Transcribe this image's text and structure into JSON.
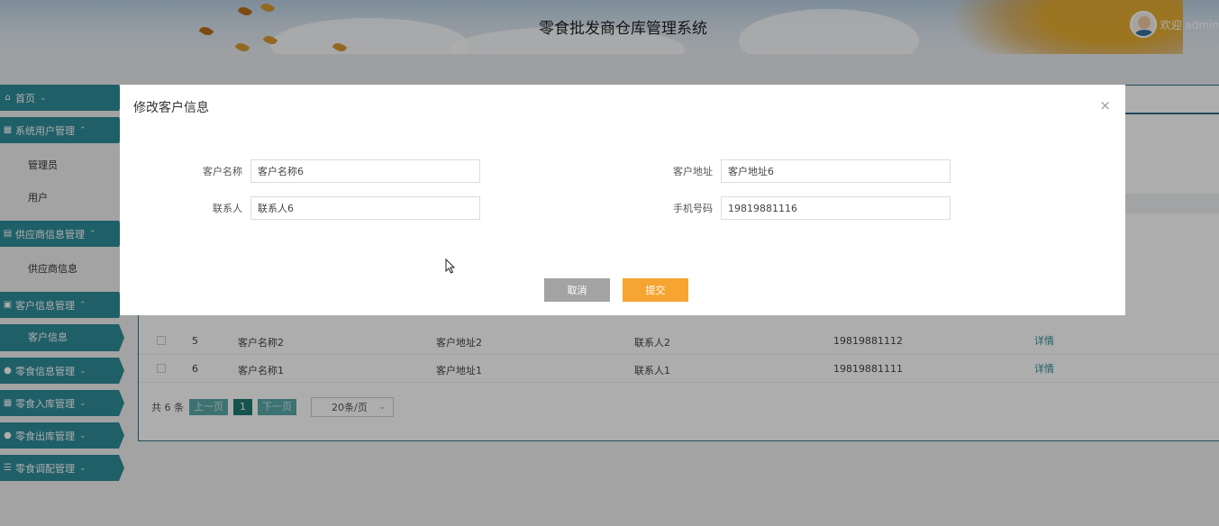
{
  "header": {
    "system_title": "零食批发商仓库管理系统",
    "welcome": "欢迎 admin"
  },
  "sidebar": {
    "items": [
      {
        "label": "首页",
        "icon": "home-icon",
        "chevron": "⌄"
      },
      {
        "label": "系统用户管理",
        "icon": "users-icon",
        "chevron": "⌃",
        "children": [
          "管理员",
          "用户"
        ]
      },
      {
        "label": "供应商信息管理",
        "icon": "book-icon",
        "chevron": "⌃",
        "children": [
          "供应商信息"
        ]
      },
      {
        "label": "客户信息管理",
        "icon": "grid-icon",
        "chevron": "⌃",
        "children": [
          "客户信息"
        ]
      },
      {
        "label": "零食信息管理",
        "icon": "circle-icon",
        "chevron": "⌄"
      },
      {
        "label": "零食入库管理",
        "icon": "grid-icon",
        "chevron": "⌄"
      },
      {
        "label": "零食出库管理",
        "icon": "circle-icon",
        "chevron": "⌄"
      },
      {
        "label": "零食调配管理",
        "icon": "list-icon",
        "chevron": "⌄"
      }
    ]
  },
  "table": {
    "rows": [
      {
        "id": "5",
        "name": "客户名称2",
        "address": "客户地址2",
        "contact": "联系人2",
        "phone": "19819881112",
        "action": "详情"
      },
      {
        "id": "6",
        "name": "客户名称1",
        "address": "客户地址1",
        "contact": "联系人1",
        "phone": "19819881111",
        "action": "详情"
      }
    ]
  },
  "pager": {
    "total": "共 6 条",
    "prev": "上一页",
    "current": "1",
    "next": "下一页",
    "page_size": "20条/页"
  },
  "modal": {
    "title": "修改客户信息",
    "close": "×",
    "fields": {
      "name_label": "客户名称",
      "name_value": "客户名称6",
      "address_label": "客户地址",
      "address_value": "客户地址6",
      "contact_label": "联系人",
      "contact_value": "联系人6",
      "phone_label": "手机号码",
      "phone_value": "19819881116"
    },
    "cancel": "取消",
    "submit": "提交"
  },
  "colors": {
    "accent": "#2f8d9a",
    "submit": "#f6a532",
    "cancel": "#a3a3a3"
  }
}
